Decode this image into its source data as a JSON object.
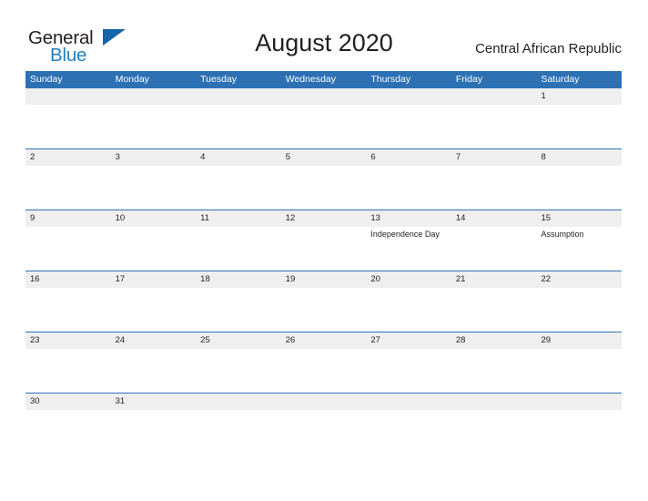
{
  "brand": {
    "name_part1": "General",
    "name_part2": "Blue",
    "flag_icon": "blue-triangle-flag-icon",
    "color_dark": "#231f20",
    "color_blue": "#1f7fc4"
  },
  "header": {
    "title": "August 2020",
    "country": "Central African Republic"
  },
  "theme": {
    "header_blue": "#2d71b4",
    "date_band_gray": "#efefef",
    "page_background": "#ffffff",
    "text_color": "#231f20",
    "header_text_color": "#ffffff"
  },
  "calendar": {
    "weekdays": [
      "Sunday",
      "Monday",
      "Tuesday",
      "Wednesday",
      "Thursday",
      "Friday",
      "Saturday"
    ],
    "weeks": [
      {
        "days": [
          {
            "number": "",
            "events": []
          },
          {
            "number": "",
            "events": []
          },
          {
            "number": "",
            "events": []
          },
          {
            "number": "",
            "events": []
          },
          {
            "number": "",
            "events": []
          },
          {
            "number": "",
            "events": []
          },
          {
            "number": "1",
            "events": []
          }
        ]
      },
      {
        "days": [
          {
            "number": "2",
            "events": []
          },
          {
            "number": "3",
            "events": []
          },
          {
            "number": "4",
            "events": []
          },
          {
            "number": "5",
            "events": []
          },
          {
            "number": "6",
            "events": []
          },
          {
            "number": "7",
            "events": []
          },
          {
            "number": "8",
            "events": []
          }
        ]
      },
      {
        "days": [
          {
            "number": "9",
            "events": []
          },
          {
            "number": "10",
            "events": []
          },
          {
            "number": "11",
            "events": []
          },
          {
            "number": "12",
            "events": []
          },
          {
            "number": "13",
            "events": [
              "Independence Day"
            ]
          },
          {
            "number": "14",
            "events": []
          },
          {
            "number": "15",
            "events": [
              "Assumption"
            ]
          }
        ]
      },
      {
        "days": [
          {
            "number": "16",
            "events": []
          },
          {
            "number": "17",
            "events": []
          },
          {
            "number": "18",
            "events": []
          },
          {
            "number": "19",
            "events": []
          },
          {
            "number": "20",
            "events": []
          },
          {
            "number": "21",
            "events": []
          },
          {
            "number": "22",
            "events": []
          }
        ]
      },
      {
        "days": [
          {
            "number": "23",
            "events": []
          },
          {
            "number": "24",
            "events": []
          },
          {
            "number": "25",
            "events": []
          },
          {
            "number": "26",
            "events": []
          },
          {
            "number": "27",
            "events": []
          },
          {
            "number": "28",
            "events": []
          },
          {
            "number": "29",
            "events": []
          }
        ]
      },
      {
        "days": [
          {
            "number": "30",
            "events": []
          },
          {
            "number": "31",
            "events": []
          },
          {
            "number": "",
            "events": []
          },
          {
            "number": "",
            "events": []
          },
          {
            "number": "",
            "events": []
          },
          {
            "number": "",
            "events": []
          },
          {
            "number": "",
            "events": []
          }
        ]
      }
    ]
  }
}
